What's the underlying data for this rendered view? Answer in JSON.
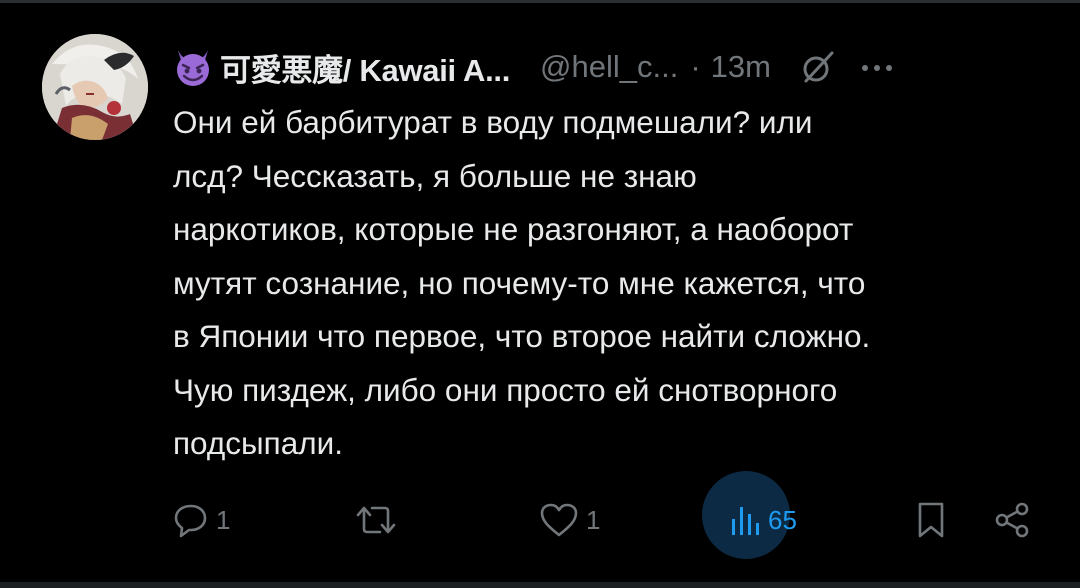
{
  "author": {
    "name_emoji": "devil-face-emoji",
    "display_name": "可愛悪魔/ Kawaii A...",
    "handle": "@hell_c...",
    "separator": "·",
    "time": "13m"
  },
  "tweet": {
    "text": "Они ей барбитурат в воду подмешали? или\nлсд? Чессказать, я больше не знаю\nнаркотиков, которые не разгоняют, а наоборот\nмутят сознание, но почему-то мне кажется, что\nв Японии что первое, что второе найти сложно.\nЧую пиздеж, либо они просто ей снотворного\nподсыпали."
  },
  "actions": {
    "replies": "1",
    "reposts": "",
    "likes": "1",
    "views": "65"
  },
  "colors": {
    "background": "#000000",
    "text": "#e7e9ea",
    "muted": "#71767b",
    "accent": "#1d9bf0",
    "views_highlight": "#0c2a43"
  }
}
